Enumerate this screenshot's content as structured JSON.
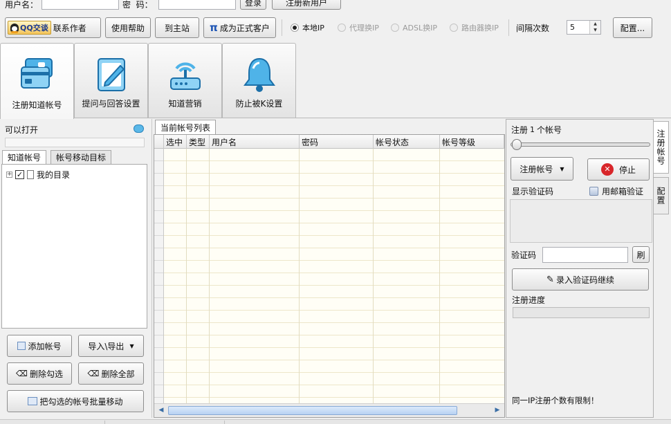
{
  "login": {
    "username_label": "用户名：",
    "password_label": "密  码：",
    "login_button": "登录",
    "register_button": "注册新用户"
  },
  "toolbar": {
    "qq_badge": "QQ交谈",
    "contact_author": "联系作者",
    "help": "使用帮助",
    "go_home": "到主站",
    "become_customer_icon": "π",
    "become_customer": "成为正式客户",
    "radios": [
      {
        "label": "本地IP",
        "selected": true,
        "enabled": true
      },
      {
        "label": "代理换IP",
        "selected": false,
        "enabled": false
      },
      {
        "label": "ADSL换IP",
        "selected": false,
        "enabled": false
      },
      {
        "label": "路由器换IP",
        "selected": false,
        "enabled": false
      }
    ],
    "interval_label": "间隔次数",
    "interval_value": "5",
    "config_button": "配置..."
  },
  "big_tabs": [
    {
      "label": "注册知道帐号",
      "icon": "cards-icon",
      "active": true
    },
    {
      "label": "提问与回答设置",
      "icon": "pencil-note-icon",
      "active": false
    },
    {
      "label": "知道营销",
      "icon": "router-icon",
      "active": false
    },
    {
      "label": "防止被K设置",
      "icon": "bell-icon",
      "active": false
    }
  ],
  "left_panel": {
    "openable_label": "可以打开",
    "tabs": [
      "知道帐号",
      "帐号移动目标"
    ],
    "tree_root_label": "我的目录",
    "add_account": "添加帐号",
    "import_export": "导入\\导出",
    "delete_checked": "删除勾选",
    "delete_all": "删除全部",
    "batch_move": "把勾选的帐号批量移动"
  },
  "center_panel": {
    "tab_label": "当前帐号列表",
    "columns": [
      "选中",
      "类型",
      "用户名",
      "密码",
      "帐号状态",
      "帐号等级"
    ]
  },
  "right_panel": {
    "register_count_prefix": "注册",
    "register_count": "1",
    "register_count_suffix": "个帐号",
    "slider_value": 0,
    "register_button": "注册帐号",
    "stop_button": "停止",
    "show_captcha_label": "显示验证码",
    "email_verify_label": "用邮箱验证",
    "captcha_label": "验证码",
    "refresh_button": "刷",
    "submit_captcha_button": "录入验证码继续",
    "progress_label": "注册进度",
    "progress_value": 0,
    "ip_limit_note": "同一IP注册个数有限制！",
    "side_tabs": [
      "注册帐号",
      "配置"
    ]
  }
}
